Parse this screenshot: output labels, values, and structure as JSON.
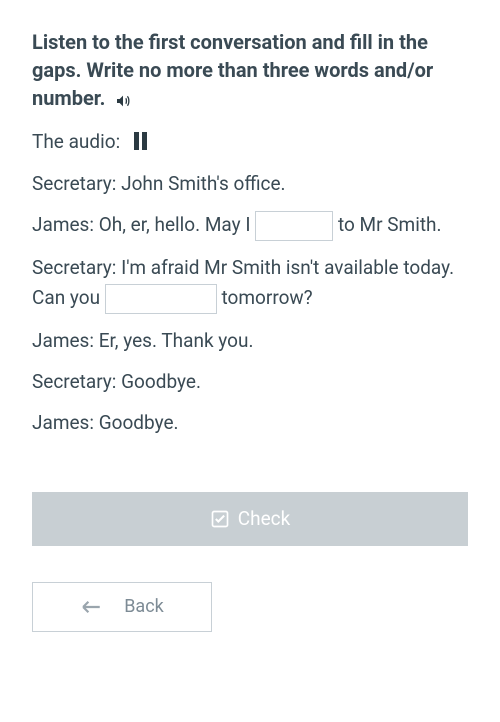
{
  "title": "Listen to the first conversation and fill in the gaps. Write no more than three words and/or number.",
  "audio_label": "The audio:",
  "dialogue": {
    "line1_speaker": "Secretary:",
    "line1_text": "John Smith's office.",
    "line2_speaker": "James:",
    "line2_pre": "Oh, er, hello. May I",
    "line2_post": "to Mr Smith.",
    "line3_speaker": "Secretary:",
    "line3_pre": "I'm afraid Mr Smith isn't available today. Can you",
    "line3_post": "tomorrow?",
    "line4_speaker": "James:",
    "line4_text": "Er, yes. Thank you.",
    "line5_speaker": "Secretary:",
    "line5_text": "Goodbye.",
    "line6_speaker": "James:",
    "line6_text": "Goodbye."
  },
  "gap1_value": "",
  "gap2_value": "",
  "check_label": "Check",
  "back_label": "Back"
}
